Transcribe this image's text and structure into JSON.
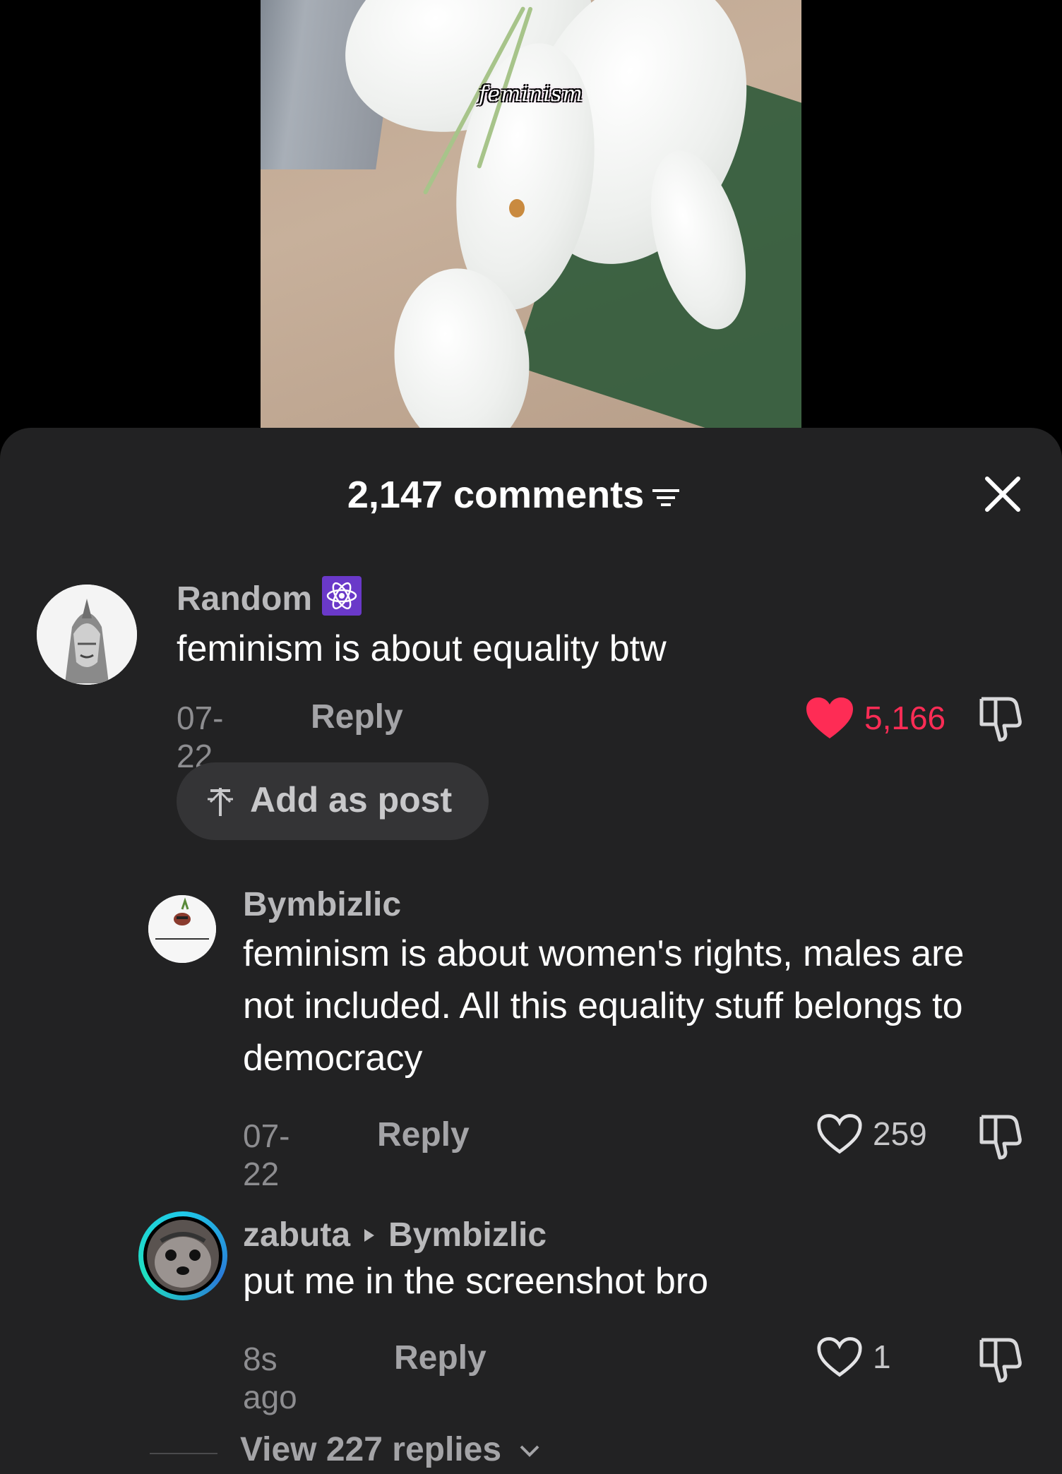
{
  "video": {
    "caption": "feminism"
  },
  "sheet": {
    "comment_count": "2,147 comments"
  },
  "comments": [
    {
      "username": "Random",
      "text": "feminism is about equality btw",
      "date": "07-22",
      "reply_label": "Reply",
      "likes": "5,166",
      "liked": true,
      "add_post_label": "Add as post"
    },
    {
      "username": "Bymbizlic",
      "text": "feminism is about women's rights, males are not included. All this equality stuff belongs to democracy",
      "date": "07-22",
      "reply_label": "Reply",
      "likes": "259",
      "liked": false
    },
    {
      "username": "zabuta",
      "reply_to": "Bymbizlic",
      "text": "put me in the screenshot bro",
      "date": "8s ago",
      "reply_label": "Reply",
      "likes": "1",
      "liked": false
    }
  ],
  "view_replies": "View 227 replies",
  "colors": {
    "sheet_bg": "#222223",
    "liked_heart": "#fe2c55",
    "muted_text": "#8d8d90"
  }
}
